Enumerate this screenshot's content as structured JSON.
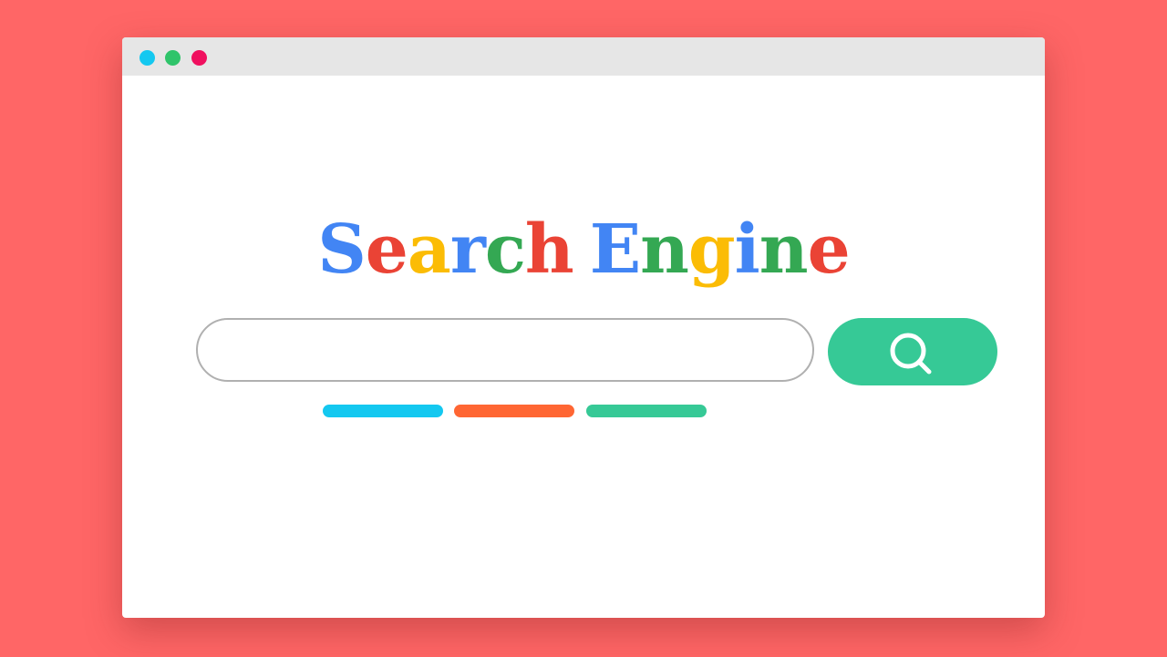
{
  "background_color": "#ff6666",
  "window": {
    "titlebar_dots": [
      {
        "icon": "window-dot-cyan",
        "color": "#14c8f0"
      },
      {
        "icon": "window-dot-green",
        "color": "#2fc46a"
      },
      {
        "icon": "window-dot-pink",
        "color": "#f0105f"
      }
    ]
  },
  "logo": {
    "text": "Search Engine",
    "letters": [
      {
        "char": "S",
        "color": "#4285f4"
      },
      {
        "char": "e",
        "color": "#ea4335"
      },
      {
        "char": "a",
        "color": "#fbbc05"
      },
      {
        "char": "r",
        "color": "#4285f4"
      },
      {
        "char": "c",
        "color": "#34a853"
      },
      {
        "char": "h",
        "color": "#ea4335"
      },
      {
        "char": "E",
        "color": "#4285f4"
      },
      {
        "char": "n",
        "color": "#34a853"
      },
      {
        "char": "g",
        "color": "#fbbc05"
      },
      {
        "char": "i",
        "color": "#4285f4"
      },
      {
        "char": "n",
        "color": "#34a853"
      },
      {
        "char": "e",
        "color": "#ea4335"
      }
    ]
  },
  "search": {
    "value": "",
    "placeholder": "",
    "button_icon": "search-icon",
    "button_color": "#36c996"
  },
  "suggestion_bars": [
    {
      "color": "#14c8f0"
    },
    {
      "color": "#ff6633"
    },
    {
      "color": "#36c996"
    }
  ]
}
